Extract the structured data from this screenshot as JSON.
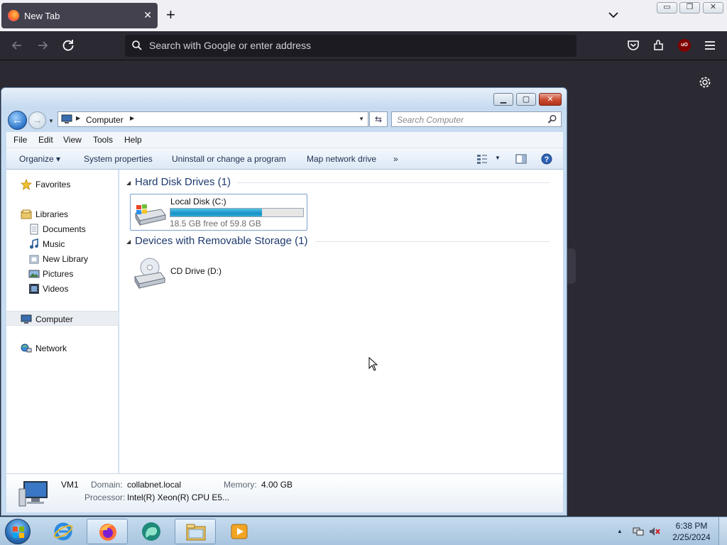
{
  "browser": {
    "tab": {
      "title": "New Tab",
      "close": "✕"
    },
    "new_tab": "+",
    "url_placeholder": "Search with Google or enter address",
    "window_buttons": {
      "minimize": "▭",
      "restore": "❐",
      "close": "✕"
    },
    "extension_label": "uO"
  },
  "explorer": {
    "caption_buttons": {
      "minimize": "▁",
      "maximize": "▢",
      "close": "✕"
    },
    "address": {
      "crumb": "Computer"
    },
    "search_placeholder": "Search Computer",
    "menu": [
      "File",
      "Edit",
      "View",
      "Tools",
      "Help"
    ],
    "commands": {
      "organize": "Organize ▾",
      "system_properties": "System properties",
      "uninstall": "Uninstall or change a program",
      "map_drive": "Map network drive",
      "more": "»"
    },
    "nav": {
      "favorites": "Favorites",
      "libraries": "Libraries",
      "documents": "Documents",
      "music": "Music",
      "new_library": "New Library",
      "pictures": "Pictures",
      "videos": "Videos",
      "computer": "Computer",
      "network": "Network"
    },
    "groups": {
      "hdd": "Hard Disk Drives (1)",
      "removable": "Devices with Removable Storage (1)"
    },
    "drives": {
      "c": {
        "name": "Local Disk (C:)",
        "free_text": "18.5 GB free of 59.8 GB",
        "used_fraction": 0.69
      },
      "d": {
        "name": "CD Drive (D:)"
      }
    },
    "details": {
      "name": "VM1",
      "domain_key": "Domain:",
      "domain_val": "collabnet.local",
      "memory_key": "Memory:",
      "memory_val": "4.00 GB",
      "processor_key": "Processor:",
      "processor_val": "Intel(R) Xeon(R) CPU E5..."
    }
  },
  "taskbar": {
    "time": "6:38 PM",
    "date": "2/25/2024"
  }
}
